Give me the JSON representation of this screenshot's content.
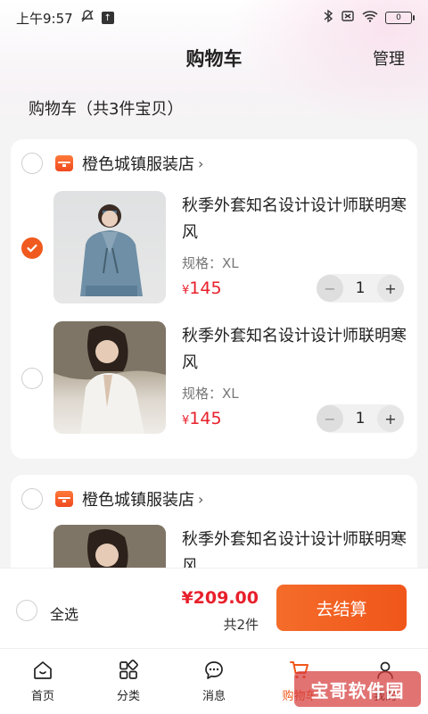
{
  "status_bar": {
    "time": "上午9:57",
    "battery": "0"
  },
  "header": {
    "title": "购物车",
    "manage": "管理"
  },
  "cart_summary": "购物车（共3件宝贝）",
  "stores": [
    {
      "name": "橙色城镇服装店",
      "items": [
        {
          "title": "秋季外套知名设计设计师联明寒风",
          "spec": "规格：XL",
          "currency": "¥",
          "price": "145",
          "quantity": "1",
          "checked": true
        },
        {
          "title": "秋季外套知名设计设计师联明寒风",
          "spec": "规格：XL",
          "currency": "¥",
          "price": "145",
          "quantity": "1",
          "checked": false
        }
      ]
    },
    {
      "name": "橙色城镇服装店",
      "items": [
        {
          "title": "秋季外套知名设计设计师联明寒风"
        }
      ]
    }
  ],
  "checkout": {
    "select_all": "全选",
    "total": "¥209.00",
    "count": "共2件",
    "button": "去结算"
  },
  "tabs": [
    {
      "label": "首页",
      "icon": "home-icon"
    },
    {
      "label": "分类",
      "icon": "category-icon"
    },
    {
      "label": "消息",
      "icon": "message-icon"
    },
    {
      "label": "购物车",
      "icon": "cart-icon",
      "active": true
    },
    {
      "label": "我的",
      "icon": "user-icon"
    }
  ],
  "watermark": "宝哥软件园",
  "colors": {
    "accent": "#f0561a",
    "price": "#e8202b"
  }
}
